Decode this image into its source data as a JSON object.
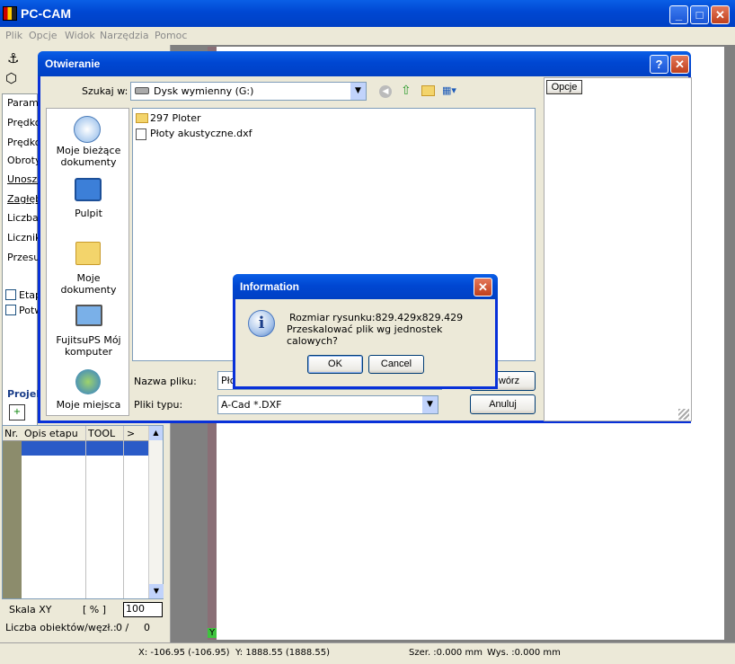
{
  "app": {
    "title": "PC-CAM",
    "menu": [
      "Plik",
      "Opcje",
      "Widok",
      "Narzędzia",
      "Pomoc"
    ]
  },
  "left_panel": {
    "params": [
      "Param.",
      "Prędko",
      "Prędko",
      "Obroty",
      "Unosze",
      "Zagłęb",
      "Liczba",
      "Licznik",
      "Przesu"
    ],
    "checkboxes": [
      "Etap",
      "Potw"
    ],
    "project_label": "Projek",
    "table_headers": [
      "Nr.",
      "Opis etapu",
      "TOOL",
      ">"
    ],
    "scale_label": "Skala XY",
    "scale_unit": "[ % ]",
    "scale_value": "100",
    "objects_label": "Liczba obiektów/węzł.:",
    "objects_value": "0 /",
    "objects_value2": "0"
  },
  "status_bar": {
    "x": "X: -106.95 (-106.95)",
    "y": "Y: 1888.55 (1888.55)",
    "width": "Szer. :0.000 mm",
    "height": "Wys. :0.000 mm"
  },
  "y_marker": "Y",
  "open_dialog": {
    "title": "Otwieranie",
    "look_in_label": "Szukaj w:",
    "look_in_value": "Dysk wymienny (G:)",
    "places": [
      "Moje bieżące dokumenty",
      "Pulpit",
      "Moje dokumenty",
      "FujitsuPS Mój komputer",
      "Moje miejsca"
    ],
    "files": [
      "297 Ploter",
      "Płoty akustyczne.dxf"
    ],
    "filename_label": "Nazwa pliku:",
    "filename_value": "Pło",
    "filetype_label": "Pliki typu:",
    "filetype_value": "A-Cad *.DXF",
    "open_button": "wórz",
    "cancel_button": "Anuluj",
    "options_button": "Opcje"
  },
  "info_dialog": {
    "title": "Information",
    "line1": "Rozmiar rysunku:829.429x829.429",
    "line2": "Przeskalować plik wg jednostek calowych?",
    "ok": "OK",
    "cancel": "Cancel"
  },
  "colors": {
    "titlebar": "#0047d2",
    "dialog_bg": "#ece9d8"
  }
}
